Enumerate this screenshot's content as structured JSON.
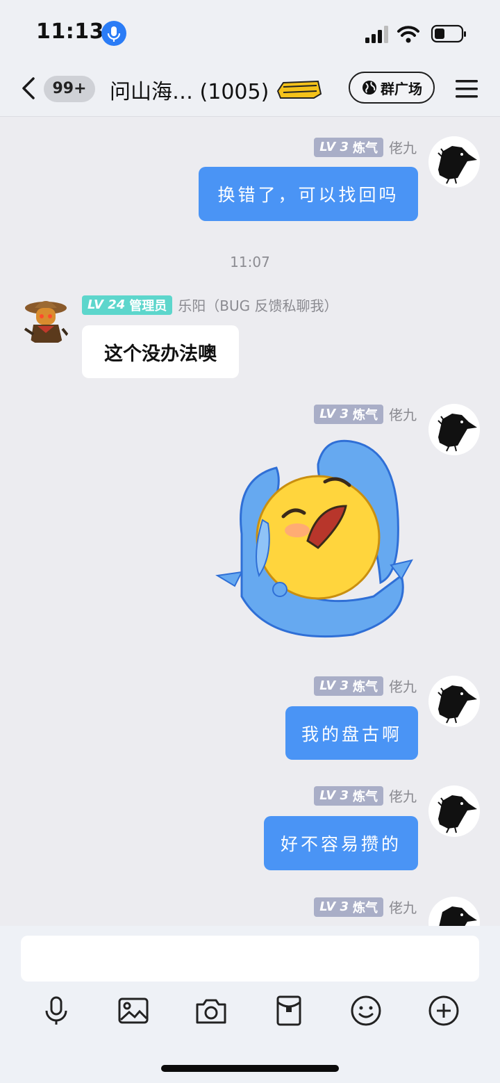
{
  "status_bar": {
    "time": "11:13"
  },
  "nav": {
    "back_badge": "99+",
    "title": "问山海… (1005)",
    "square_button": "群广场"
  },
  "messages": [
    {
      "sender": "佬九",
      "level": "LV 3",
      "title": "炼气",
      "text": "换错了，可以找回吗"
    },
    {
      "timestamp": "11:07"
    },
    {
      "sender": "乐阳（BUG 反馈私聊我）",
      "level": "LV 24",
      "title": "管理员",
      "text": "这个没办法噢"
    },
    {
      "sender": "佬九",
      "level": "LV 3",
      "title": "炼气",
      "sticker": "crying-emoji-sticker"
    },
    {
      "sender": "佬九",
      "level": "LV 3",
      "title": "炼气",
      "text": "我的盘古啊"
    },
    {
      "sender": "佬九",
      "level": "LV 3",
      "title": "炼气",
      "text": "好不容易攒的"
    },
    {
      "sender": "佬九",
      "level": "LV 3",
      "title": "炼气"
    }
  ],
  "composer": {
    "input_value": "",
    "tools": [
      "microphone-icon",
      "image-icon",
      "camera-icon",
      "red-packet-icon",
      "emoji-icon",
      "plus-icon"
    ]
  },
  "colors": {
    "outgoing_bubble": "#4a94f5",
    "admin_tag": "#5dd6cc",
    "level_tag": "#a9aec7",
    "background": "#ececf0"
  }
}
